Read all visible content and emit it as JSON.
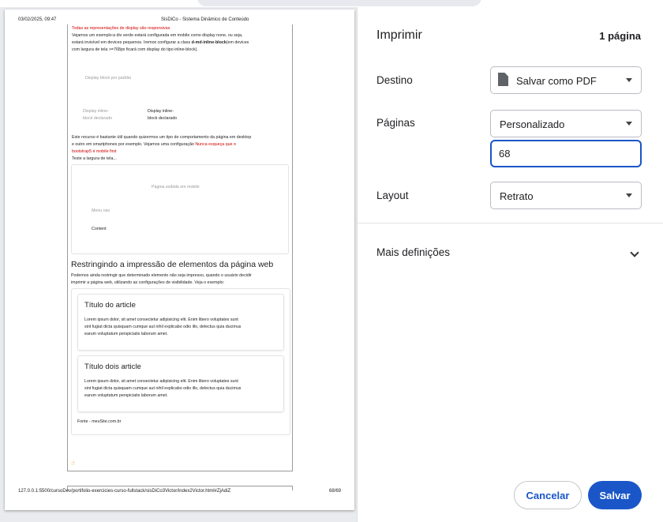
{
  "preview": {
    "header_datetime": "03/02/2025, 09:47",
    "header_title": "SisDiCo - Sistema Dinâmico de Conteúdo",
    "footer_url": "127.0.0.1:5500/cursoDev/portifolio-exercicies-curso-fullstack/sisDiCo3Victor/index2Victor.html#ZjAdiZ",
    "footer_page": "68/69",
    "red_note": "Todas as representações de display são responsivas",
    "para1_a": "Vejamos um exemplo:a div verde estará configurada em mobile como display none, ou seja,",
    "para1_b": "estará invisível em devices pequenos. Iremos configurar a class",
    "para1_bold": "d-md-inline-block",
    "para1_c": "(em devices",
    "para1_d": "com largura de tela >=768px ficará com display do tipo inline-block).",
    "demo_block": "Display block por padrão",
    "demo_inline_light_1": "Display inline-",
    "demo_inline_light_2": "block declarado",
    "demo_inline_1": "Display inline-",
    "demo_inline_2": "block declarado",
    "para2_a": "Este recurso é bastante útil quando quizermos um tipo de comportamento da página em desktop",
    "para2_b": "e outro em smartphones por exemplo. Vejamos uma configuração",
    "para2_red": "Nunca esqueça que o",
    "para2_red2": "bootstrap5 é mobile first",
    "para2_c": "Teste a largura de tela...",
    "mobile_page": "Página exibida em mobile",
    "mobile_menu": "Menu nav",
    "mobile_content": "Content",
    "section_title": "Restringindo a impressão de elementos da página web",
    "section_p_a": "Podemos ainda restringir que determinado elemento não seja impresso, quando o usuário decidir",
    "section_p_b": "imprimir a página web, utilizando as configurações de visibilidade. Veja o exemplo:",
    "article1_title": "Título do article",
    "article2_title": "Título dois article",
    "lorem_a": "Lorem ipsum dolor, sit amet consectetur adipisicing elit. Enim libero voluptates sunt",
    "lorem_b": "sint fugiat dicta quisquam cumque aut nihil explicabo odio illo, delectus quia ducimus",
    "lorem_c": "earum voluptatum perspiciatis laborum amet.",
    "source": "Fonte - meuSite.com.br",
    "hand": "☝"
  },
  "panel": {
    "title": "Imprimir",
    "page_count": "1 página",
    "destination_label": "Destino",
    "destination_value": "Salvar como PDF",
    "pages_label": "Páginas",
    "pages_value": "Personalizado",
    "pages_input": "68",
    "layout_label": "Layout",
    "layout_value": "Retrato",
    "more_settings": "Mais definições",
    "cancel": "Cancelar",
    "save": "Salvar"
  },
  "icons": {
    "pdf": "document-icon",
    "dropdown": "caret-down-icon",
    "expand": "chevron-down-icon"
  },
  "colors": {
    "accent": "#1a56c8",
    "note_red": "#d00000"
  }
}
